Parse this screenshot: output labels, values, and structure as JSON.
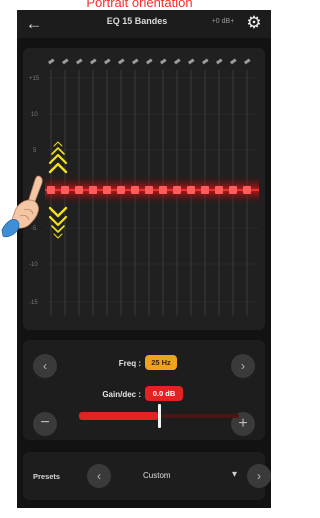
{
  "caption": "Portrait orientation",
  "topbar": {
    "back_icon": "arrow-left-icon",
    "title": "EQ 15 Bandes",
    "db_label": "+0 dB+",
    "settings_icon": "gear-icon"
  },
  "eq": {
    "band_count": 15,
    "y_labels": [
      "+15",
      "10",
      "5",
      "0",
      "-5",
      "-10",
      "-15"
    ],
    "gesture": {
      "icon": "pointing-hand-icon",
      "hint": "swipe-up-down-chevrons"
    },
    "accent_color": "#d41c1c"
  },
  "controls": {
    "prev_icon": "chevron-left-icon",
    "next_icon": "chevron-right-icon",
    "freq_label": "Freq :",
    "freq_value": "25 Hz",
    "gain_label": "Gain/dec :",
    "gain_value": "0.0 dB",
    "minus_icon": "minus-icon",
    "plus_icon": "plus-icon",
    "slider_level_percent": 50,
    "freq_badge_color": "#f0a21c",
    "gain_badge_color": "#e32222"
  },
  "presets": {
    "label": "Presets",
    "prev_icon": "chevron-left-icon",
    "value": "Custom",
    "dropdown_icon": "chevron-down-icon",
    "next_icon": "chevron-right-icon"
  }
}
